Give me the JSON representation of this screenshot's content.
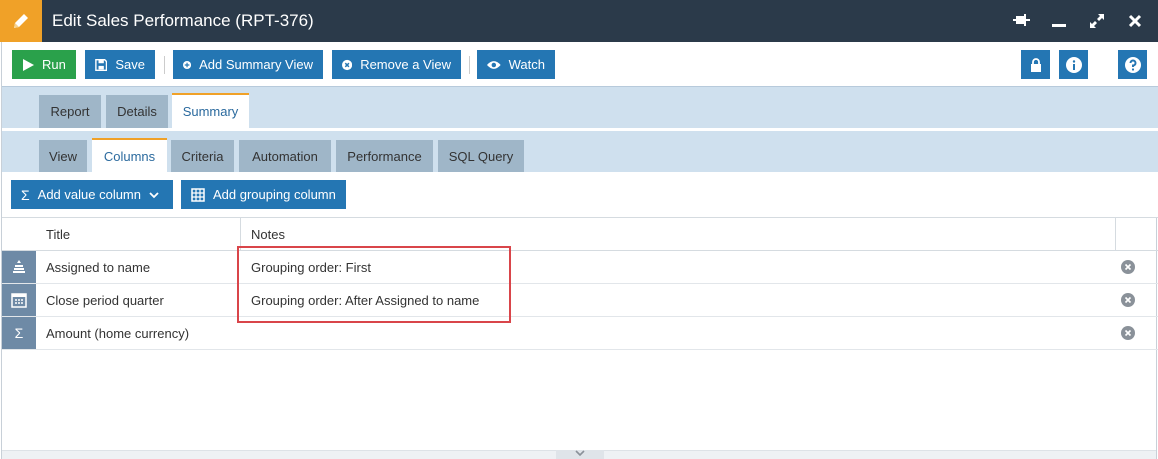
{
  "window": {
    "title": "Edit Sales Performance (RPT-376)",
    "title_icon": "pencil-icon",
    "controls": [
      "pin-icon",
      "minimize-icon",
      "maximize-icon",
      "close-icon"
    ]
  },
  "toolbar": {
    "run_label": "Run",
    "save_label": "Save",
    "add_summary_view_label": "Add Summary View",
    "remove_view_label": "Remove a View",
    "watch_label": "Watch",
    "right_icons": [
      "lock-icon",
      "info-icon",
      "help-icon"
    ]
  },
  "tabs_level1": [
    {
      "label": "Report",
      "active": false
    },
    {
      "label": "Details",
      "active": false
    },
    {
      "label": "Summary",
      "active": true
    }
  ],
  "tabs_level2": [
    {
      "label": "View",
      "active": false
    },
    {
      "label": "Columns",
      "active": true
    },
    {
      "label": "Criteria",
      "active": false
    },
    {
      "label": "Automation",
      "active": false
    },
    {
      "label": "Performance",
      "active": false
    },
    {
      "label": "SQL Query",
      "active": false
    }
  ],
  "actions": {
    "add_value_column_label": "Add value column",
    "add_grouping_column_label": "Add grouping column"
  },
  "grid": {
    "headers": {
      "title": "Title",
      "notes": "Notes"
    },
    "rows": [
      {
        "icon": "people-stack-icon",
        "title": "Assigned to name",
        "notes": "Grouping order: First"
      },
      {
        "icon": "calendar-icon",
        "title": "Close period quarter",
        "notes": "Grouping order: After Assigned to name"
      },
      {
        "icon": "sigma-icon",
        "title": "Amount (home currency)",
        "notes": ""
      }
    ]
  },
  "colors": {
    "titlebar": "#2b3a4a",
    "accent_orange": "#f0a128",
    "primary_blue": "#2476b3",
    "run_green": "#2aa14b",
    "highlight_red": "#d9454a"
  }
}
